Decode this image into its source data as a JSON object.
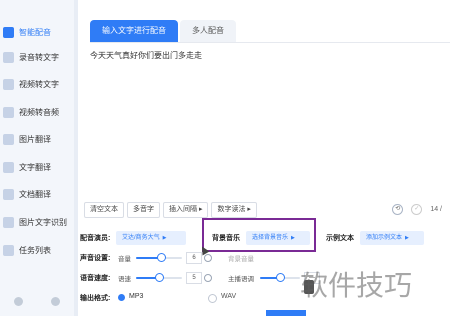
{
  "sidebar": {
    "items": [
      {
        "label": "智能配音",
        "active": true
      },
      {
        "label": "录音转文字"
      },
      {
        "label": "视频转文字"
      },
      {
        "label": "视频转音频"
      },
      {
        "label": "图片翻译"
      },
      {
        "label": "文字翻译"
      },
      {
        "label": "文档翻译"
      },
      {
        "label": "图片文字识别"
      },
      {
        "label": "任务列表"
      }
    ]
  },
  "tabs": [
    {
      "label": "输入文字进行配音",
      "active": true
    },
    {
      "label": "多人配音",
      "active": false
    }
  ],
  "editor": {
    "text": "今天天气真好你们要出门多走走"
  },
  "toolbar": {
    "clear": "清空文本",
    "polyphone": "多音字",
    "pause": "插入间隔 ▸",
    "digits": "数字读法 ▸",
    "count": "14 /"
  },
  "voice": {
    "label": "配音演员:",
    "value": "艾达/商务大气"
  },
  "bgm": {
    "label": "背景音乐",
    "value": "选择背景音乐"
  },
  "sample": {
    "label": "示例文本",
    "value": "添加示例文本"
  },
  "sound": {
    "label": "声音设置:",
    "volume_label": "音量",
    "volume_value": "6",
    "volume_level": 0.55,
    "bg_label": "背景音量"
  },
  "speed": {
    "label": "语音速度:",
    "speed_label": "语速",
    "speed_value": "5",
    "speed_level": 0.5,
    "main_label": "主播语调",
    "main_value": "—"
  },
  "format": {
    "label": "输出格式:",
    "option1": "MP3",
    "option2": "WAV"
  },
  "watermark": "软件技巧",
  "colors": {
    "accent": "#2f7cf6",
    "highlight": "#7a2a95"
  }
}
